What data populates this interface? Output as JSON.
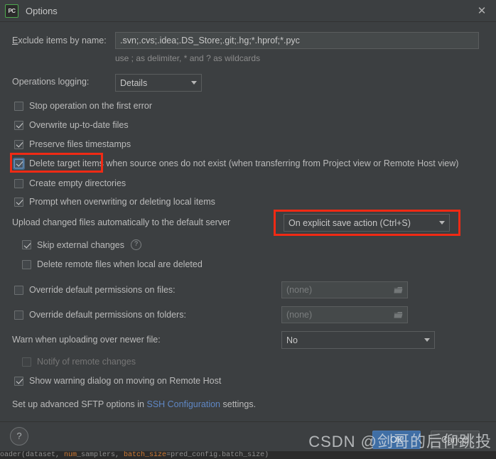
{
  "window": {
    "title": "Options",
    "logo_text": "PC",
    "close_label": "✕"
  },
  "form": {
    "exclude_label": "xclude items by name:",
    "exclude_label_mnemonic": "E",
    "exclude_value": ".svn;.cvs;.idea;.DS_Store;.git;.hg;*.hprof;*.pyc",
    "exclude_hint": "use ; as delimiter, * and ? as wildcards",
    "logging_label": "Operations logging:",
    "logging_value": "Details",
    "upload_label": "Upload changed files automatically to the default server",
    "upload_value": "On explicit save action (Ctrl+S)",
    "permissions_files_label": "Override default permissions on files:",
    "permissions_files_value": "(none)",
    "permissions_folders_label": "Override default permissions on folders:",
    "permissions_folders_value": "(none)",
    "warn_label": "Warn when uploading over newer file:",
    "warn_value": "No",
    "sftp_note_prefix": "Set up advanced SFTP options in ",
    "sftp_note_link": "SSH Configuration",
    "sftp_note_suffix": " settings.",
    "help_icon_glyph": "?"
  },
  "checkboxes": [
    {
      "label": "Stop operation on the first error",
      "checked": false,
      "disabled": false,
      "focused": false
    },
    {
      "label": "Overwrite up-to-date files",
      "checked": true,
      "disabled": false,
      "focused": false
    },
    {
      "label": "Preserve files timestamps",
      "checked": true,
      "disabled": false,
      "focused": false
    },
    {
      "label": "Delete target items when source ones do not exist (when transferring from Project view or Remote Host view)",
      "checked": true,
      "disabled": false,
      "focused": true
    },
    {
      "label": "Create empty directories",
      "checked": false,
      "disabled": false,
      "focused": false
    },
    {
      "label": "Prompt when overwriting or deleting local items",
      "checked": true,
      "disabled": false,
      "focused": false
    },
    {
      "label": "Skip external changes",
      "checked": true,
      "disabled": false,
      "focused": false
    },
    {
      "label": "Delete remote files when local are deleted",
      "checked": false,
      "disabled": false,
      "focused": false
    },
    {
      "label": "Override default permissions on files:",
      "checked": false,
      "disabled": false,
      "focused": false
    },
    {
      "label": "Override default permissions on folders:",
      "checked": false,
      "disabled": false,
      "focused": false
    },
    {
      "label": "Notify of remote changes",
      "checked": false,
      "disabled": true,
      "focused": false
    },
    {
      "label": "Show warning dialog on moving on Remote Host",
      "checked": true,
      "disabled": false,
      "focused": false
    }
  ],
  "footer": {
    "help_label": "?",
    "ok_label": "OK",
    "cancel_label": "Cancel"
  },
  "annotations": {
    "watermark": "CSDN @剑哥的后仰跳投",
    "highlight_color": "#f02a14"
  },
  "code_strip": {
    "text_1": "oader(dataset, ",
    "text_2": "num",
    "text_3": "_samplers, ",
    "text_4": "batch_size",
    "text_5": "=pred_config.batch_size)"
  }
}
